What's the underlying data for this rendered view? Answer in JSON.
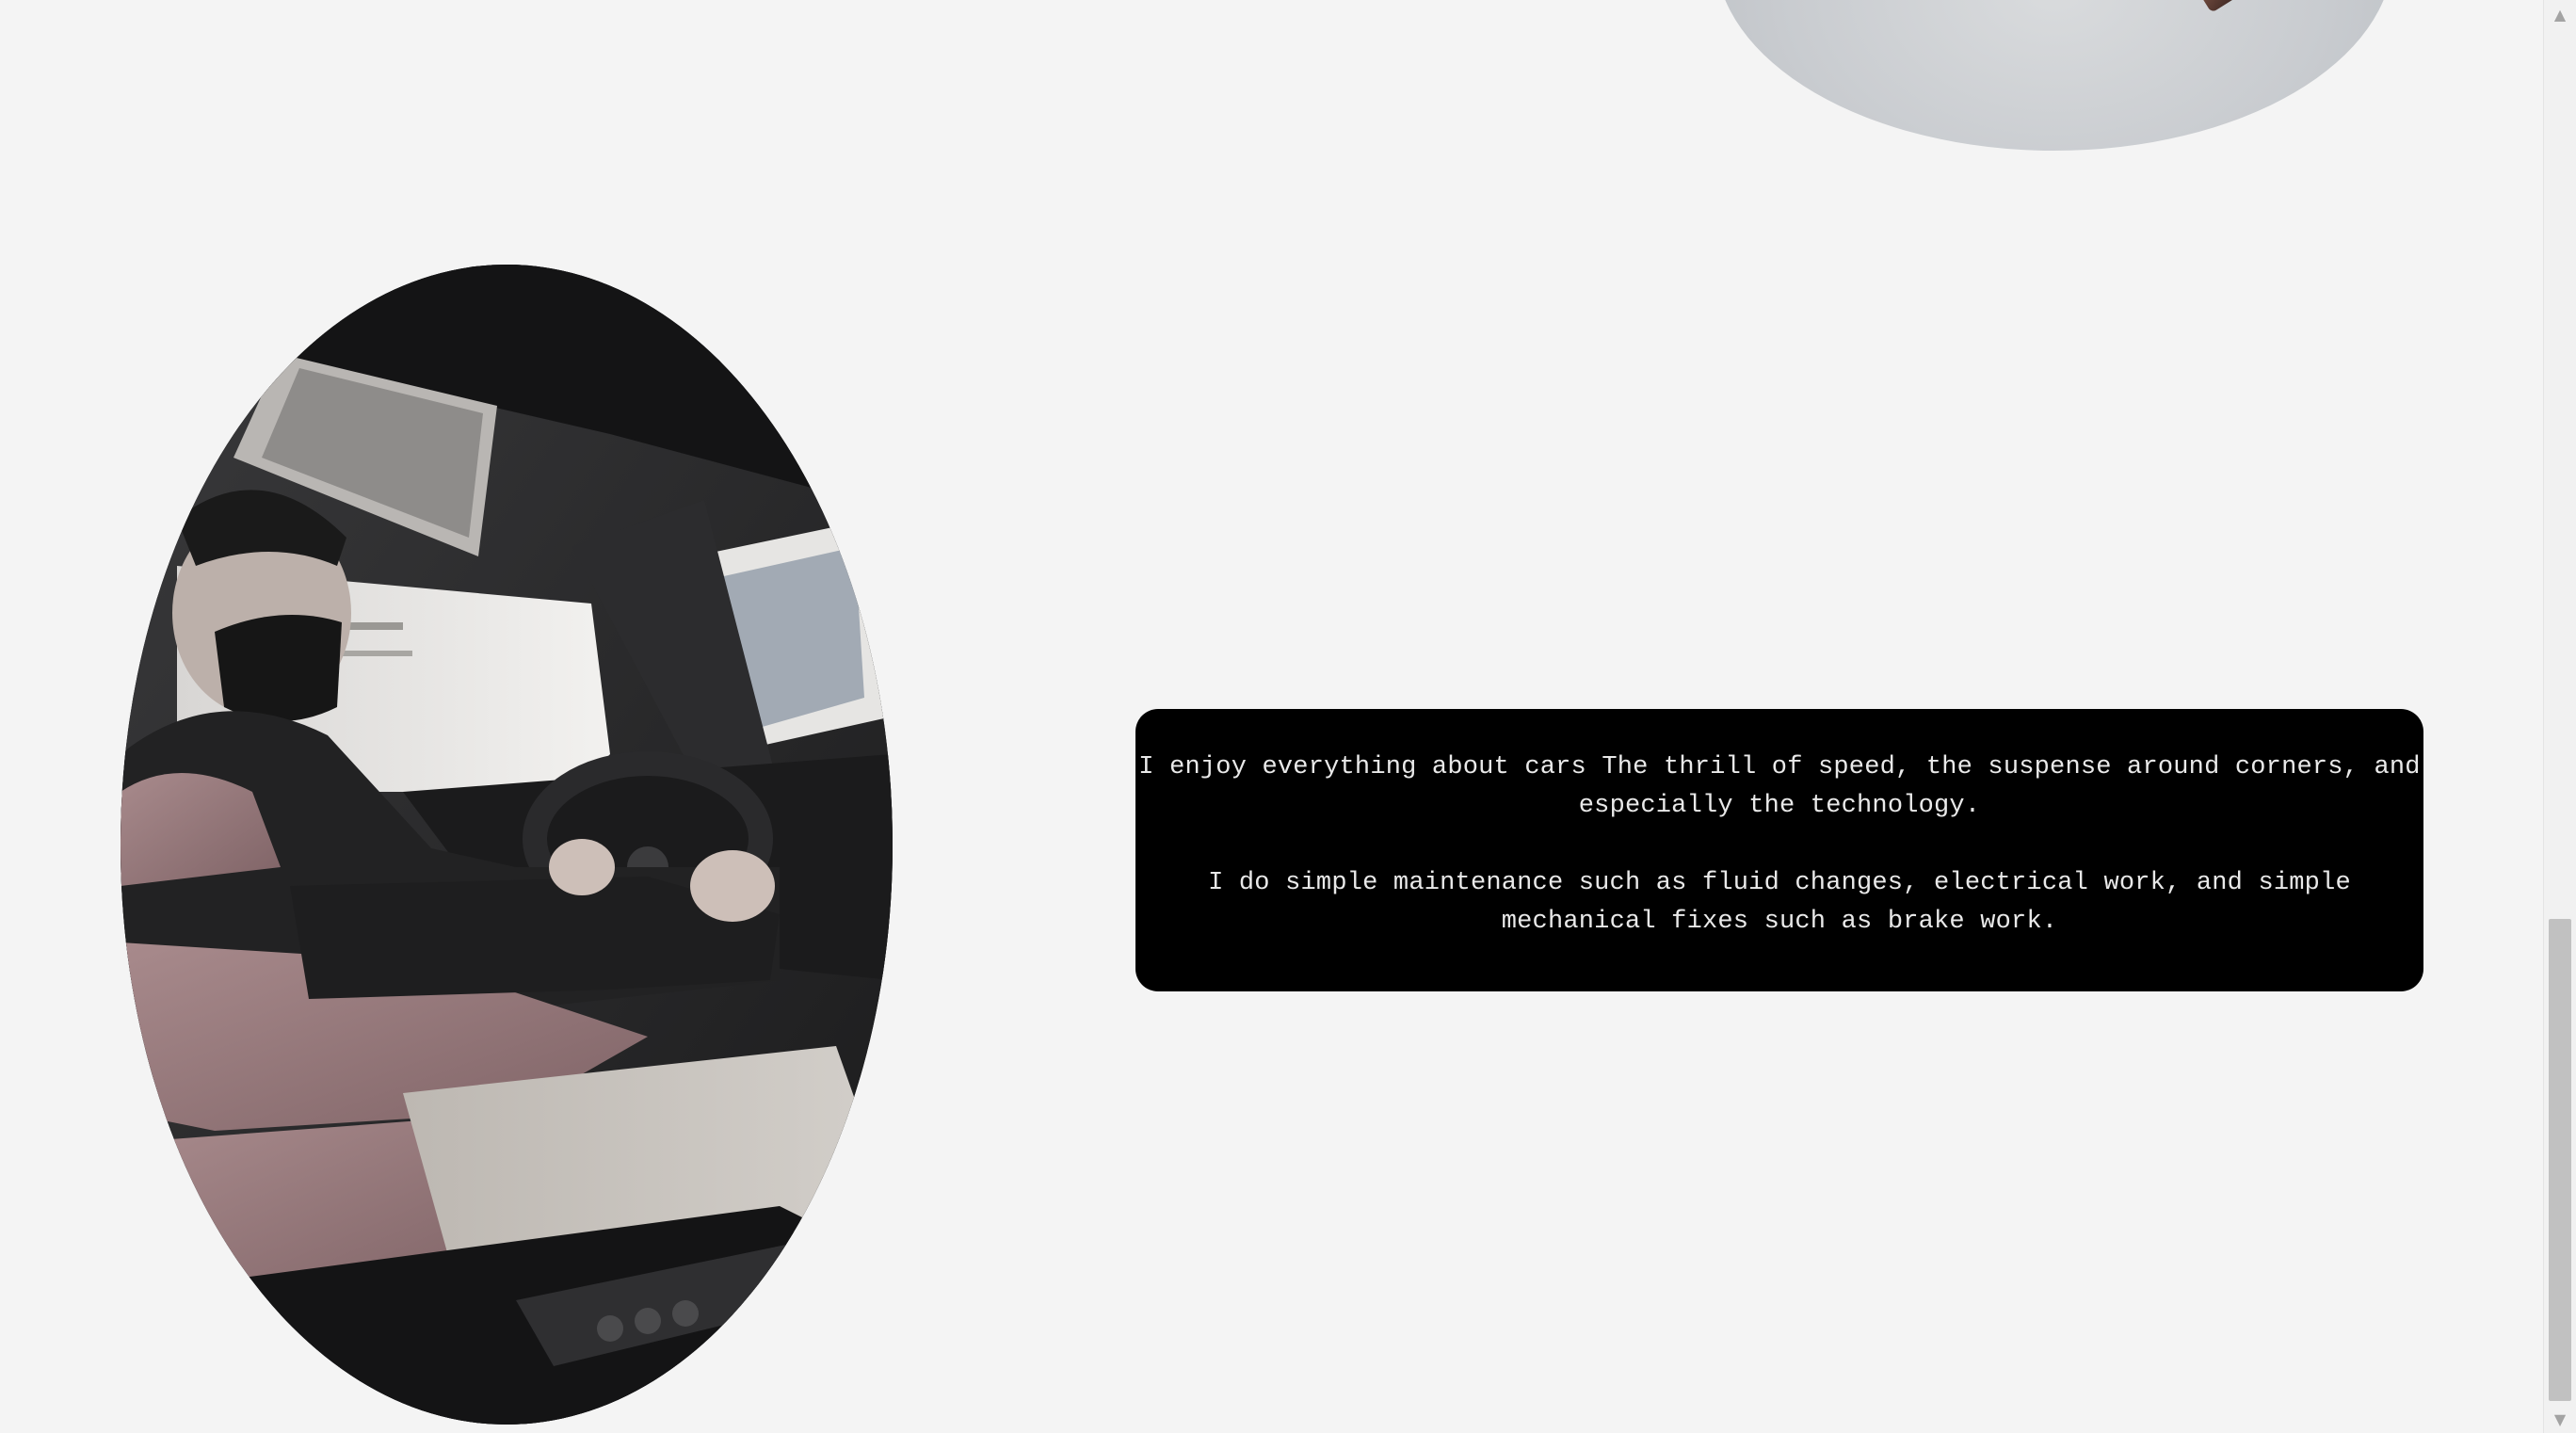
{
  "about": {
    "paragraph1": "I enjoy everything about cars The thrill of speed, the suspense around corners, and especially the technology.",
    "paragraph2": "I do simple maintenance such as fluid changes, electrical work, and simple mechanical fixes such as brake work."
  },
  "scrollbar": {
    "up_icon": "▲",
    "down_icon": "▼"
  }
}
